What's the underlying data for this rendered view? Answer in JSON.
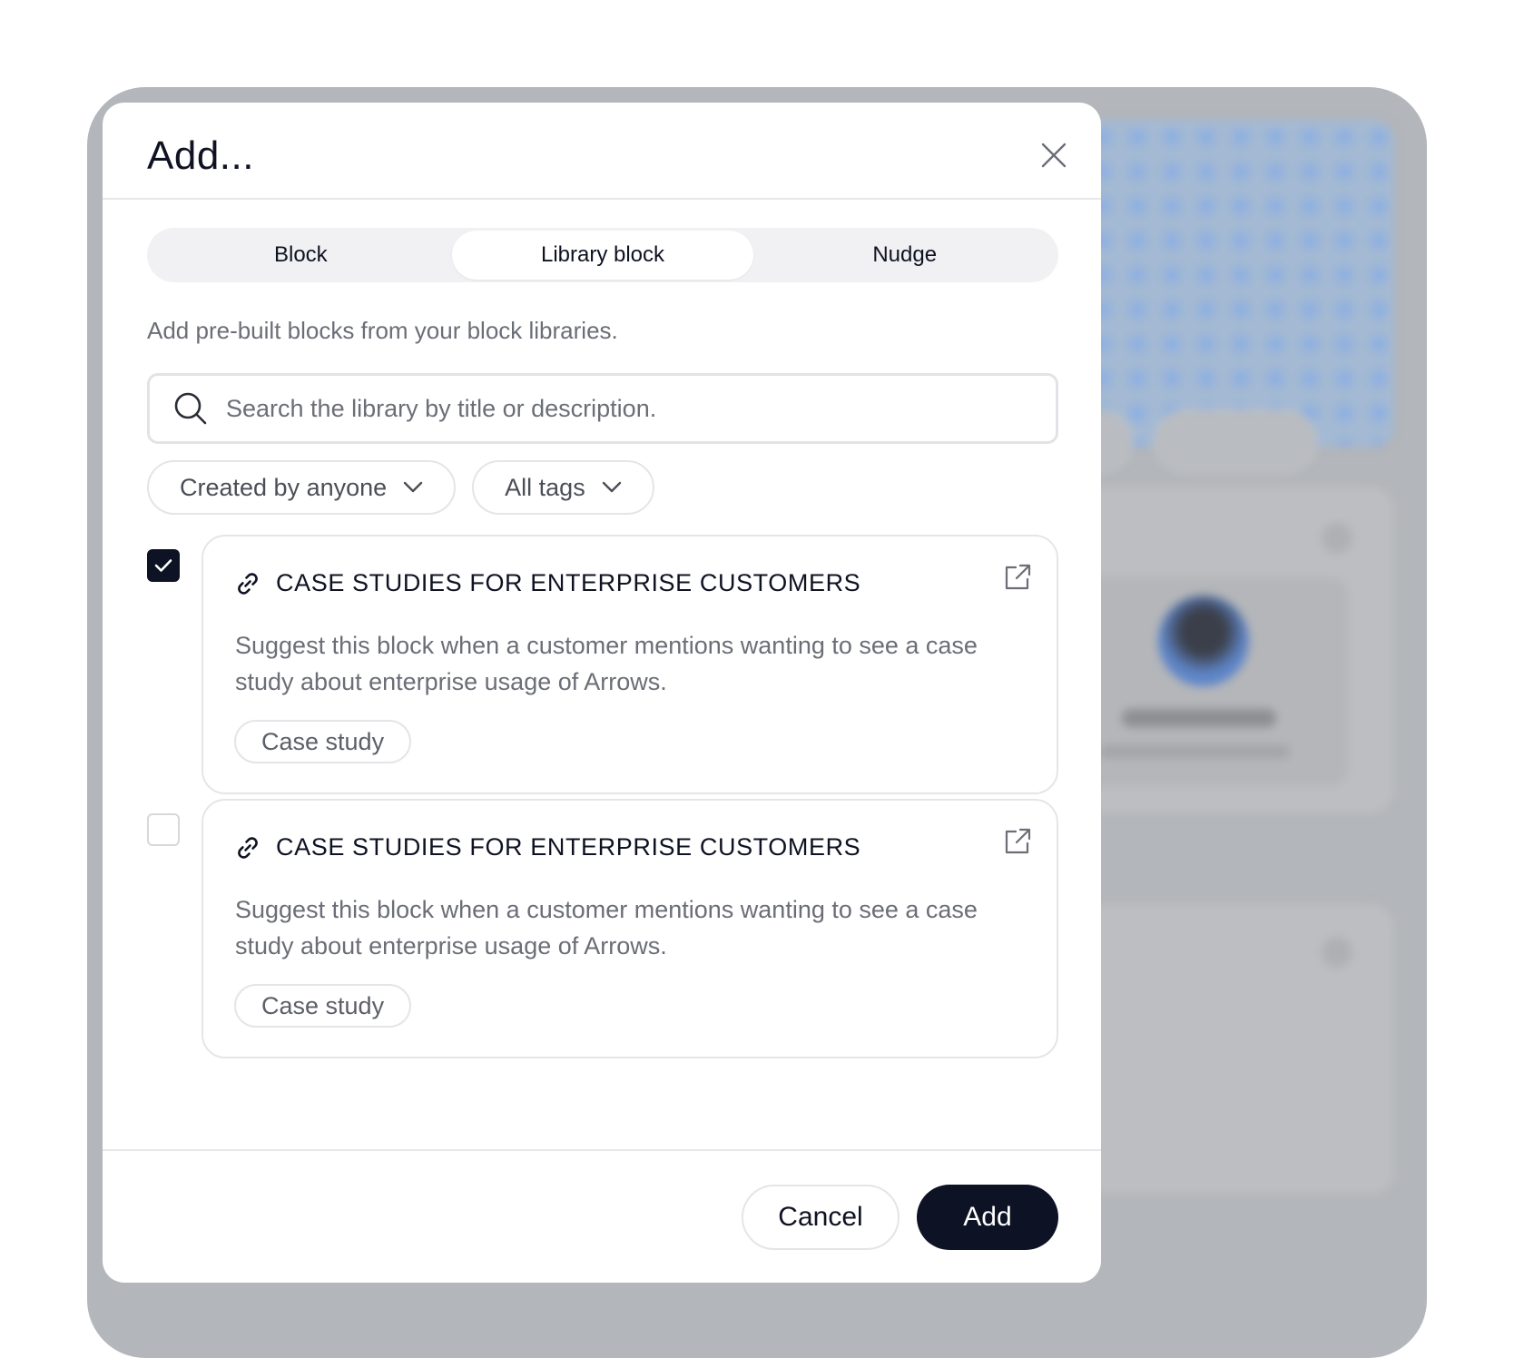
{
  "modal": {
    "title": "Add...",
    "close_icon": "close-icon"
  },
  "tabs": [
    {
      "label": "Block",
      "active": false
    },
    {
      "label": "Library block",
      "active": true
    },
    {
      "label": "Nudge",
      "active": false
    }
  ],
  "description": "Add pre-built blocks from your block libraries.",
  "search": {
    "placeholder": "Search the library by title or description.",
    "value": "",
    "icon": "search-icon"
  },
  "filters": [
    {
      "label": "Created by anyone",
      "icon": "chevron-down-icon"
    },
    {
      "label": "All tags",
      "icon": "chevron-down-icon"
    }
  ],
  "items": [
    {
      "checked": true,
      "icon": "link-icon",
      "title": "CASE STUDIES FOR ENTERPRISE CUSTOMERS",
      "description": "Suggest this block when a customer mentions wanting to see a case study about enterprise usage of Arrows.",
      "tag": "Case study",
      "action_icon": "external-link-icon"
    },
    {
      "checked": false,
      "icon": "link-icon",
      "title": "CASE STUDIES FOR ENTERPRISE CUSTOMERS",
      "description": "Suggest this block when a customer mentions wanting to see a case study about enterprise usage of Arrows.",
      "tag": "Case study",
      "action_icon": "external-link-icon"
    }
  ],
  "footer": {
    "cancel_label": "Cancel",
    "add_label": "Add"
  },
  "colors": {
    "primary": "#0d1224",
    "overlay": "#b3b6ba",
    "muted_text": "#6b6e76",
    "border": "#e4e5e8"
  }
}
